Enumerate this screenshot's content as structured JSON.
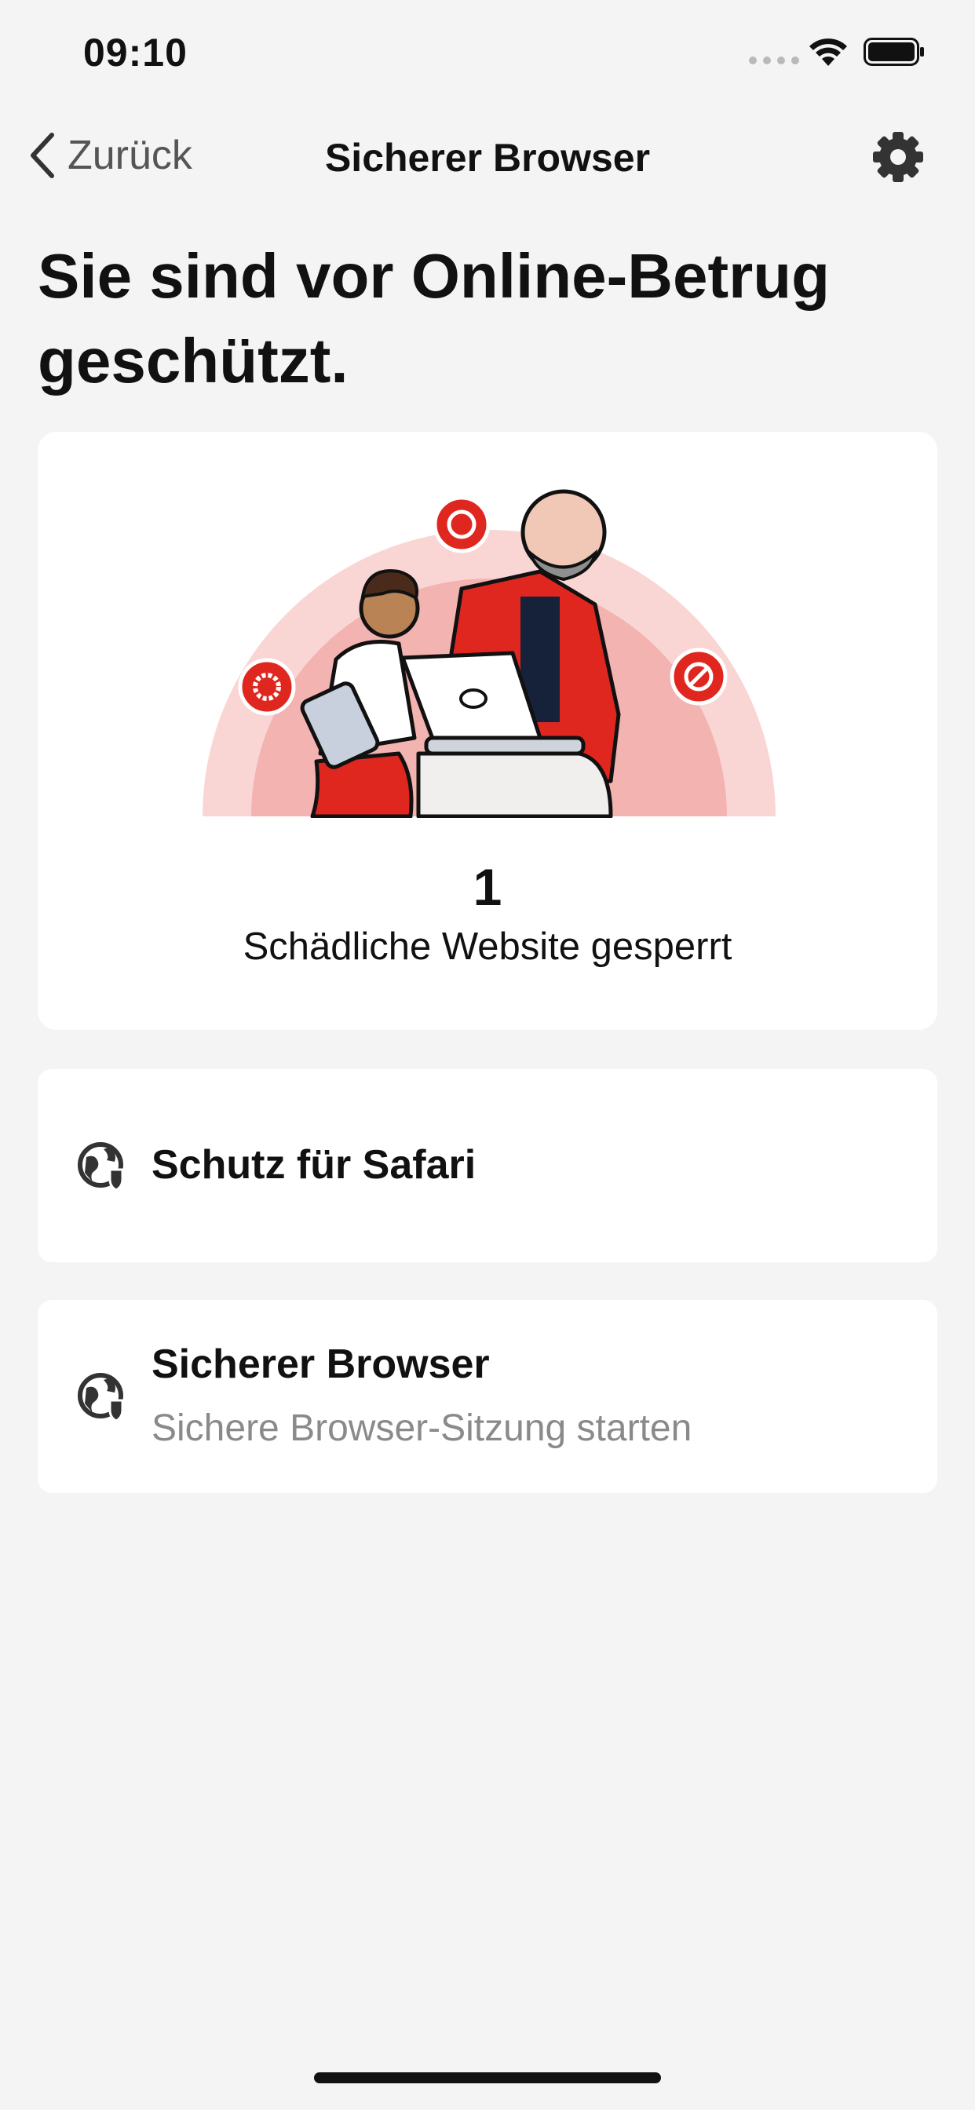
{
  "status_bar": {
    "time": "09:10"
  },
  "nav": {
    "back_label": "Zurück",
    "title": "Sicherer Browser"
  },
  "headline": "Sie sind vor Online-Betrug geschützt.",
  "hero": {
    "count": "1",
    "count_label": "Schädliche Website gesperrt"
  },
  "cards": [
    {
      "title": "Schutz für Safari",
      "icon": "globe-shield-icon"
    },
    {
      "title": "Sicherer Browser",
      "subtitle": "Sichere Browser-Sitzung starten",
      "icon": "globe-shield-icon"
    }
  ],
  "colors": {
    "accent": "#e0271f",
    "background": "#f4f4f4",
    "card": "#ffffff",
    "secondary_text": "#8a8a8a",
    "arc_outer": "#f9d6d4",
    "arc_inner": "#f3b3b0"
  }
}
